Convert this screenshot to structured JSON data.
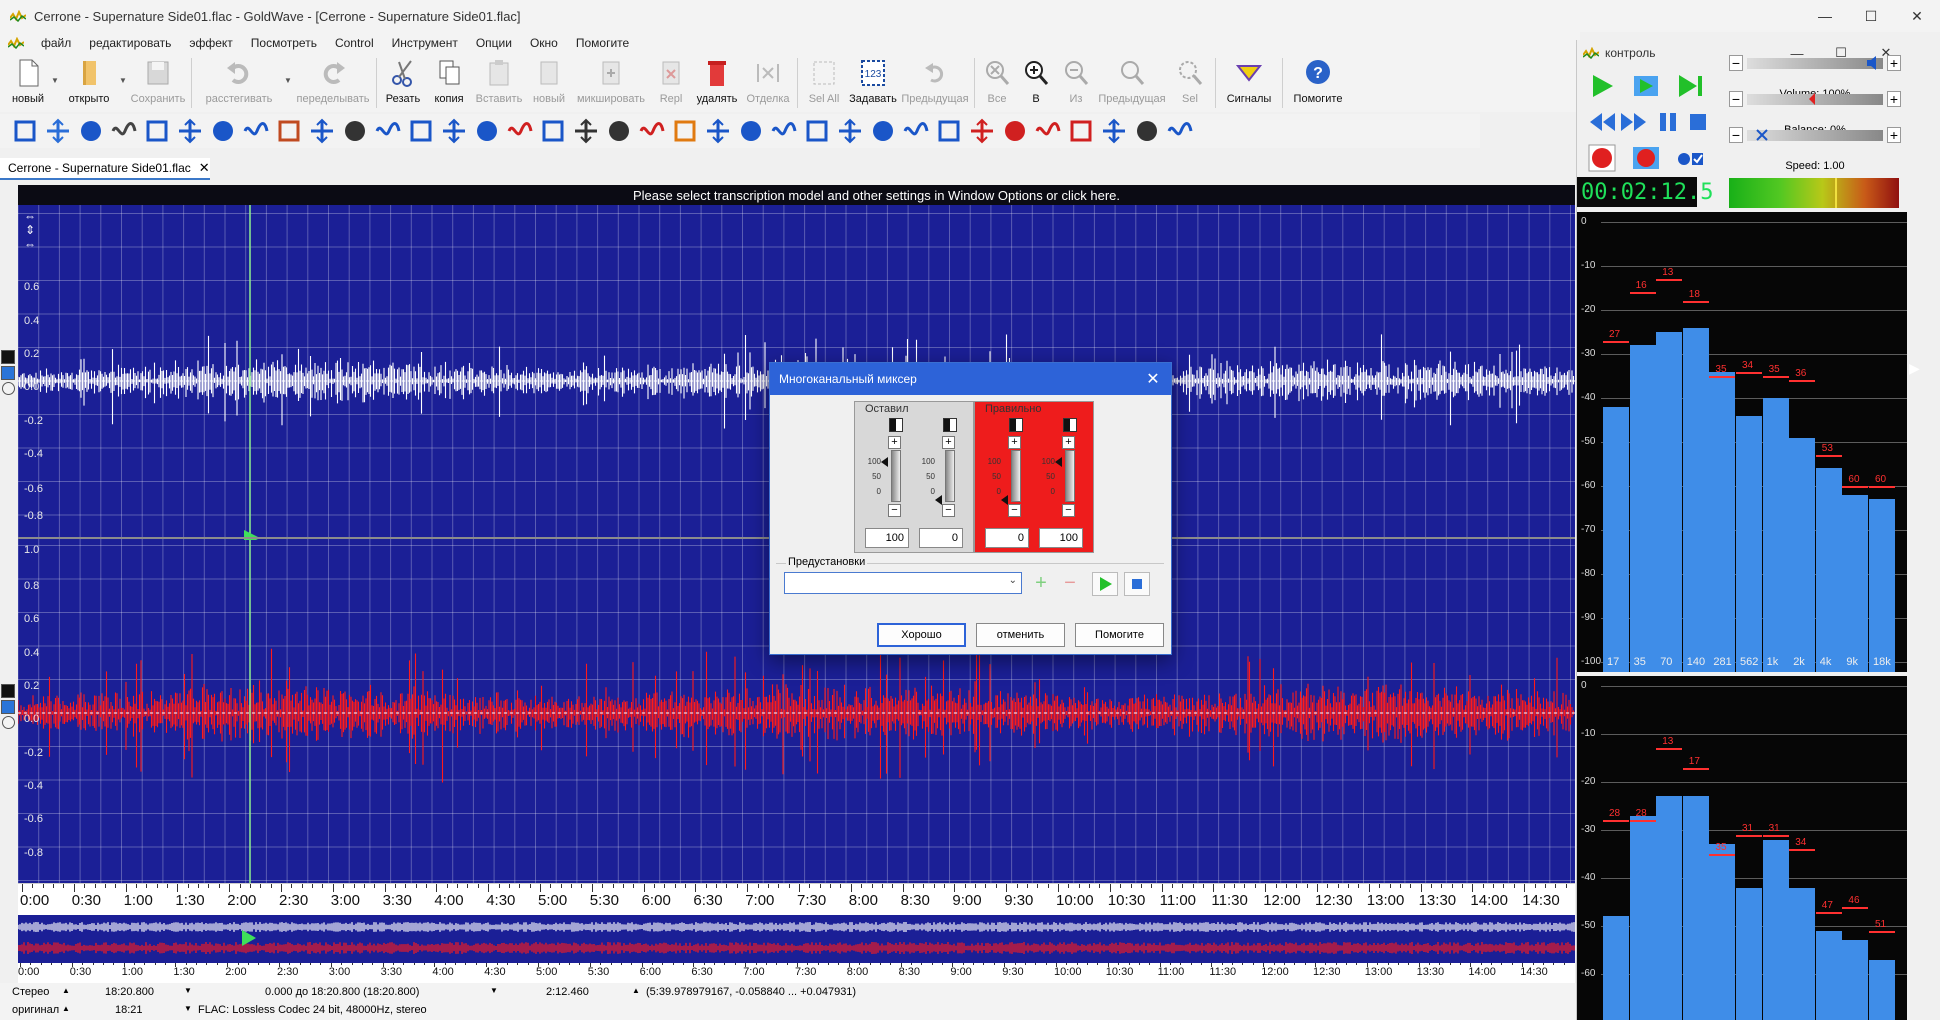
{
  "window": {
    "title": "Cerrone - Supernature Side01.flac - GoldWave - [Cerrone - Supernature Side01.flac]"
  },
  "menu": [
    "файл",
    "редактировать",
    "эффект",
    "Посмотреть",
    "Control",
    "Инструмент",
    "Опции",
    "Окно",
    "Помогите"
  ],
  "toolbar": [
    {
      "label": "новый",
      "icon": "new-file-icon",
      "enabled": true
    },
    {
      "label": "открыто",
      "icon": "open-folder-icon",
      "enabled": true
    },
    {
      "label": "Сохранить",
      "icon": "save-icon",
      "enabled": false
    },
    {
      "label": "расстегивать",
      "icon": "undo-icon",
      "enabled": false
    },
    {
      "label": "переделывать",
      "icon": "redo-icon",
      "enabled": false
    },
    {
      "label": "Резать",
      "icon": "scissors-icon",
      "enabled": true
    },
    {
      "label": "копия",
      "icon": "copy-icon",
      "enabled": true
    },
    {
      "label": "Вставить",
      "icon": "paste-icon",
      "enabled": false
    },
    {
      "label": "новый",
      "icon": "paste-new-icon",
      "enabled": false
    },
    {
      "label": "микшировать",
      "icon": "mix-icon",
      "enabled": false
    },
    {
      "label": "Repl",
      "icon": "replace-icon",
      "enabled": false
    },
    {
      "label": "удалять",
      "icon": "delete-icon",
      "enabled": true
    },
    {
      "label": "Отделка",
      "icon": "trim-icon",
      "enabled": false
    },
    {
      "label": "Sel All",
      "icon": "select-all-icon",
      "enabled": false
    },
    {
      "label": "Задавать",
      "icon": "set-selection-icon",
      "enabled": true
    },
    {
      "label": "Предыдущая",
      "icon": "previous-selection-icon",
      "enabled": false
    },
    {
      "label": "Все",
      "icon": "zoom-all-icon",
      "enabled": false
    },
    {
      "label": "В",
      "icon": "zoom-in-icon",
      "enabled": true
    },
    {
      "label": "Из",
      "icon": "zoom-out-icon",
      "enabled": false
    },
    {
      "label": "Предыдущая",
      "icon": "zoom-previous-icon",
      "enabled": false
    },
    {
      "label": "Sel",
      "icon": "zoom-selection-icon",
      "enabled": false
    },
    {
      "label": "Сигналы",
      "icon": "cue-points-icon",
      "enabled": true
    },
    {
      "label": "Помогите",
      "icon": "help-icon",
      "enabled": true
    }
  ],
  "document_tab": {
    "label": "Cerrone - Supernature Side01.flac",
    "close": "✕"
  },
  "info_banner": "Please select transcription model and other settings in Window Options or click here.",
  "channels": {
    "left_axis": [
      "0.6",
      "0.4",
      "0.2",
      "0.0",
      "-0.2",
      "-0.4",
      "-0.6",
      "-0.8"
    ],
    "right_axis": [
      "1.0",
      "0.8",
      "0.6",
      "0.4",
      "0.2",
      "0.0",
      "-0.2",
      "-0.4",
      "-0.6",
      "-0.8"
    ],
    "left_color": "#ffffff",
    "right_color": "#ff1a1a",
    "background": "#1b1f96"
  },
  "timeline": [
    "0:00",
    "0:30",
    "1:00",
    "1:30",
    "2:00",
    "2:30",
    "3:00",
    "3:30",
    "4:00",
    "4:30",
    "5:00",
    "5:30",
    "6:00",
    "6:30",
    "7:00",
    "7:30",
    "8:00",
    "8:30",
    "9:00",
    "9:30",
    "10:00",
    "10:30",
    "11:00",
    "11:30",
    "12:00",
    "12:30",
    "13:00",
    "13:30",
    "14:00",
    "14:30"
  ],
  "overview_timeline": [
    "0:00",
    "0:30",
    "1:00",
    "1:30",
    "2:00",
    "2:30",
    "3:00",
    "3:30",
    "4:00",
    "4:30",
    "5:00",
    "5:30",
    "6:00",
    "6:30",
    "7:00",
    "7:30",
    "8:00",
    "8:30",
    "9:00",
    "9:30",
    "10:00",
    "10:30",
    "11:00",
    "11:30",
    "12:00",
    "12:30",
    "13:00",
    "13:30",
    "14:00",
    "14:30"
  ],
  "status": {
    "channels": "Стерео",
    "length": "18:20.800",
    "selection": "0.000 до 18:20.800 (18:20.800)",
    "position": "2:12.460",
    "cursor": "(5:39.978979167, -0.058840 ... +0.047931)",
    "original": "оригинал",
    "orig_length": "18:21",
    "format": "FLAC: Lossless Codec 24 bit, 48000Hz, stereo"
  },
  "control": {
    "title": "контроль",
    "volume_label": "Volume: 100%",
    "balance_label": "Balance: 0%",
    "speed_label": "Speed: 1.00",
    "timer": "00:02:12.5",
    "db_scale": [
      "0",
      "-10",
      "-20",
      "-30",
      "-40",
      "-50",
      "-60",
      "-70",
      "-80",
      "-90",
      "-100"
    ],
    "freq_labels": [
      "17",
      "35",
      "70",
      "140",
      "281",
      "562",
      "1k",
      "2k",
      "4k",
      "9k",
      "18k"
    ],
    "left_spectrum": {
      "levels_db": [
        -42,
        -28,
        -25,
        -24,
        -34,
        -44,
        -40,
        -49,
        -56,
        -62,
        -63
      ],
      "peaks_db": [
        -27,
        -16,
        -13,
        -18,
        -35,
        -34,
        -35,
        -36,
        -53,
        -60,
        -60
      ]
    },
    "right_spectrum": {
      "levels_db": [
        -48,
        -27,
        -23,
        -23,
        -33,
        -42,
        -32,
        -42,
        -51,
        -53,
        -57
      ],
      "peaks_db": [
        -28,
        -28,
        -13,
        -17,
        -35,
        -31,
        -31,
        -34,
        -47,
        -46,
        -51
      ]
    }
  },
  "dialog": {
    "title": "Многоканальный миксер",
    "group_left": "Оставил",
    "group_right": "Правильно",
    "scale": [
      "100",
      "50",
      "0"
    ],
    "values": [
      "100",
      "0",
      "0",
      "100"
    ],
    "presets_label": "Предустановки",
    "ok": "Хорошо",
    "cancel": "отменить",
    "help": "Помогите",
    "right_group_color": "#ee1c1c"
  }
}
